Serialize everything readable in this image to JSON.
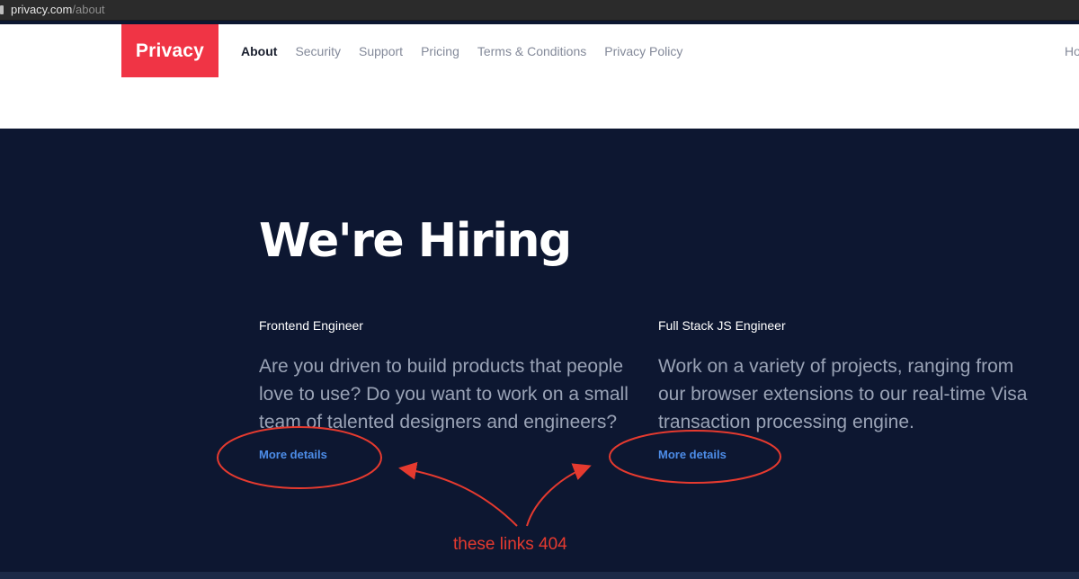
{
  "browser": {
    "url_domain": "privacy.com",
    "url_path": "/about"
  },
  "header": {
    "logo": "Privacy",
    "nav": [
      "About",
      "Security",
      "Support",
      "Pricing",
      "Terms & Conditions",
      "Privacy Policy"
    ],
    "active_nav": "About",
    "edge_label": "Ho"
  },
  "hiring": {
    "title": "We're Hiring",
    "jobs": [
      {
        "title": "Frontend Engineer",
        "description": "Are you driven to build products that people love to use? Do you want to work on a small team of talented designers and engineers?",
        "link": "More details"
      },
      {
        "title": "Full Stack JS Engineer",
        "description": "Work on a variety of projects, ranging from our browser extensions to our real-time Visa transaction processing engine.",
        "link": "More details"
      }
    ]
  },
  "annotation": {
    "text": "these links 404",
    "color": "#e53a2f"
  },
  "colors": {
    "brand": "#f03445",
    "background": "#0d1731",
    "link": "#4d8de8"
  }
}
